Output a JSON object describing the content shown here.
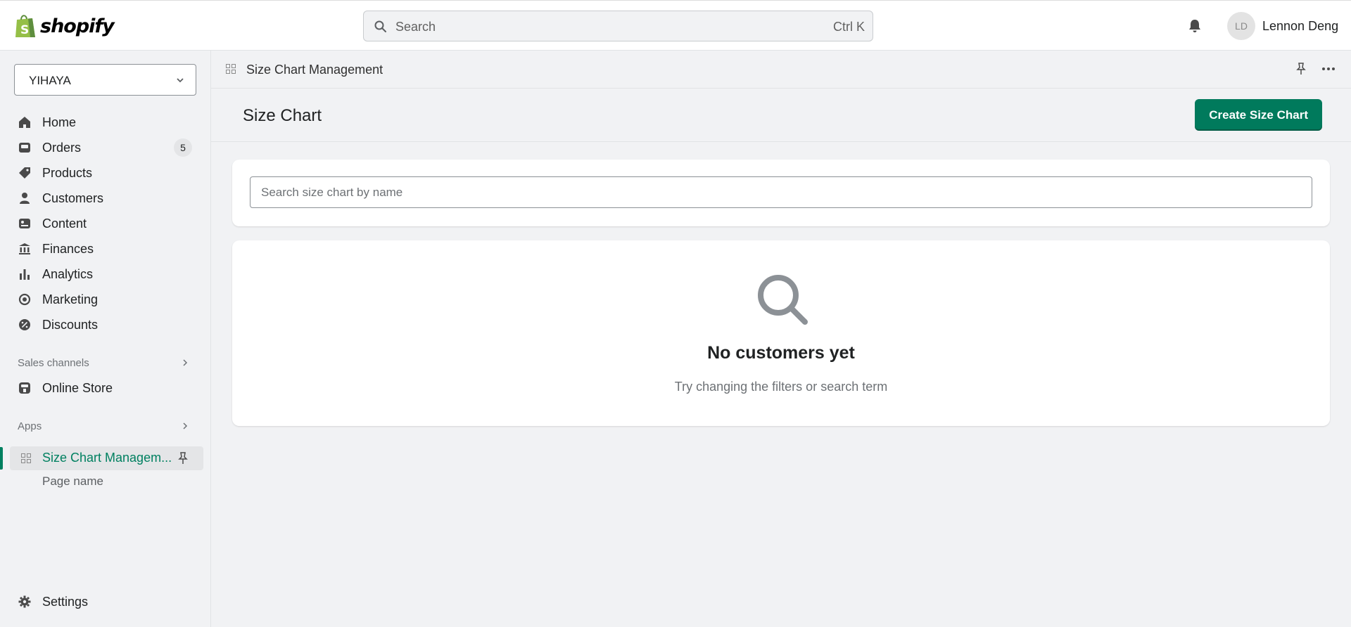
{
  "brand": {
    "name": "shopify"
  },
  "topbar": {
    "search_placeholder": "Search",
    "search_shortcut": "Ctrl K",
    "avatar_initials": "LD",
    "user_name": "Lennon Deng"
  },
  "sidebar": {
    "store": "YIHAYA",
    "items": [
      {
        "label": "Home",
        "icon": "home-icon"
      },
      {
        "label": "Orders",
        "icon": "orders-icon",
        "badge": "5"
      },
      {
        "label": "Products",
        "icon": "tag-icon"
      },
      {
        "label": "Customers",
        "icon": "person-icon"
      },
      {
        "label": "Content",
        "icon": "content-icon"
      },
      {
        "label": "Finances",
        "icon": "bank-icon"
      },
      {
        "label": "Analytics",
        "icon": "bar-chart-icon"
      },
      {
        "label": "Marketing",
        "icon": "target-icon"
      },
      {
        "label": "Discounts",
        "icon": "discount-icon"
      }
    ],
    "sales_channels_title": "Sales channels",
    "online_store": "Online Store",
    "apps_title": "Apps",
    "active_app": "Size Chart Managem...",
    "sub_page": "Page name",
    "settings": "Settings"
  },
  "main": {
    "breadcrumb": "Size Chart Management",
    "page_title": "Size Chart",
    "create_button": "Create Size Chart",
    "search_placeholder": "Search size chart by name",
    "empty_title": "No customers yet",
    "empty_subtitle": "Try changing the filters or search term"
  },
  "colors": {
    "accent": "#008060",
    "primary_button": "#007a5c",
    "background": "#f1f2f4"
  }
}
